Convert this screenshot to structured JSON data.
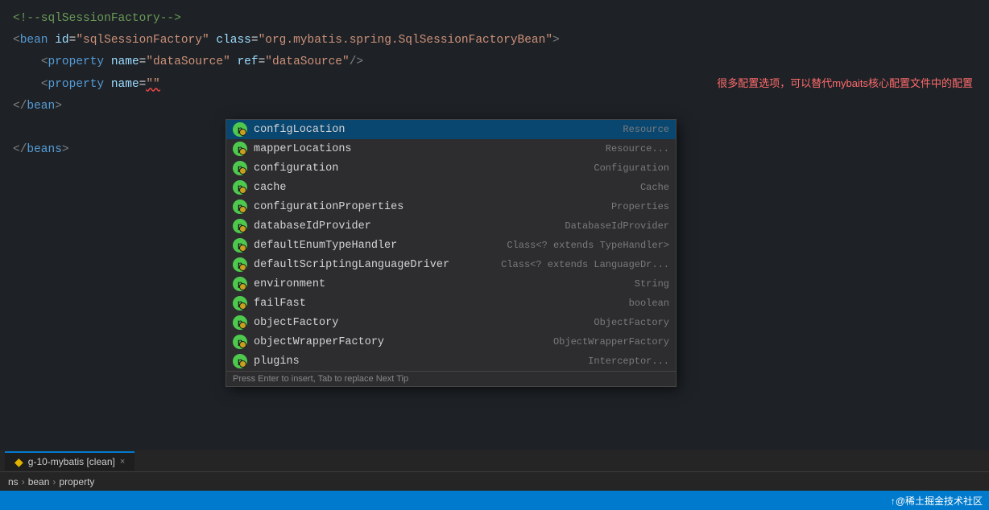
{
  "editor": {
    "background": "#1e2227",
    "lines": [
      {
        "id": "line-comment",
        "content": "<!--sqlSessionFactory-->"
      },
      {
        "id": "line-bean-open",
        "parts": [
          {
            "type": "tag-bracket",
            "text": "<"
          },
          {
            "type": "tag-name",
            "text": "bean"
          },
          {
            "type": "text",
            "text": " "
          },
          {
            "type": "attr-name",
            "text": "id"
          },
          {
            "type": "attr-equals",
            "text": "="
          },
          {
            "type": "attr-value",
            "text": "\"sqlSessionFactory\""
          },
          {
            "type": "text",
            "text": " "
          },
          {
            "type": "attr-name",
            "text": "class"
          },
          {
            "type": "attr-equals",
            "text": "="
          },
          {
            "type": "attr-value",
            "text": "\"org.mybatis.spring.SqlSessionFactoryBean\""
          },
          {
            "type": "tag-bracket",
            "text": ">"
          }
        ]
      },
      {
        "id": "line-property-datasource",
        "indent": "    ",
        "parts": [
          {
            "type": "tag-bracket",
            "text": "<"
          },
          {
            "type": "tag-name",
            "text": "property"
          },
          {
            "type": "text",
            "text": " "
          },
          {
            "type": "attr-name",
            "text": "name"
          },
          {
            "type": "attr-equals",
            "text": "="
          },
          {
            "type": "attr-value",
            "text": "\"dataSource\""
          },
          {
            "type": "text",
            "text": " "
          },
          {
            "type": "attr-name",
            "text": "ref"
          },
          {
            "type": "attr-equals",
            "text": "="
          },
          {
            "type": "attr-value",
            "text": "\"dataSource\""
          },
          {
            "type": "tag-bracket",
            "text": "/>"
          }
        ]
      },
      {
        "id": "line-property-name",
        "indent": "    ",
        "parts": [
          {
            "type": "tag-bracket",
            "text": "<"
          },
          {
            "type": "tag-name",
            "text": "property"
          },
          {
            "type": "text",
            "text": " "
          },
          {
            "type": "attr-name",
            "text": "name"
          },
          {
            "type": "attr-equals",
            "text": "="
          },
          {
            "type": "attr-value-squiggly",
            "text": "\"\""
          }
        ],
        "annotation": "很多配置选项，可以替代mybaits核心配置文件中的配置"
      },
      {
        "id": "line-bean-close",
        "parts": [
          {
            "type": "tag-bracket",
            "text": "</"
          },
          {
            "type": "tag-name",
            "text": "bean"
          },
          {
            "type": "tag-bracket",
            "text": ">"
          }
        ]
      },
      {
        "id": "line-blank"
      },
      {
        "id": "line-beans-close",
        "parts": [
          {
            "type": "tag-bracket",
            "text": "</"
          },
          {
            "type": "tag-name",
            "text": "beans"
          },
          {
            "type": "tag-bracket",
            "text": ">"
          }
        ]
      }
    ]
  },
  "autocomplete": {
    "items": [
      {
        "label": "configLocation",
        "type": "Resource",
        "selected": true
      },
      {
        "label": "mapperLocations",
        "type": "Resource..."
      },
      {
        "label": "configuration",
        "type": "Configuration"
      },
      {
        "label": "cache",
        "type": "Cache"
      },
      {
        "label": "configurationProperties",
        "type": "Properties"
      },
      {
        "label": "databaseIdProvider",
        "type": "DatabaseIdProvider"
      },
      {
        "label": "defaultEnumTypeHandler",
        "type": "Class<? extends TypeHandler>"
      },
      {
        "label": "defaultScriptingLanguageDriver",
        "type": "Class<? extends LanguageDr..."
      },
      {
        "label": "environment",
        "type": "String"
      },
      {
        "label": "failFast",
        "type": "boolean"
      },
      {
        "label": "objectFactory",
        "type": "ObjectFactory"
      },
      {
        "label": "objectWrapperFactory",
        "type": "ObjectWrapperFactory"
      },
      {
        "label": "plugins",
        "type": "Interceptor..."
      }
    ],
    "footer": "Press Enter to insert, Tab to replace   Next Tip"
  },
  "breadcrumb": {
    "items": [
      "ns",
      "bean",
      "property"
    ]
  },
  "tab": {
    "label": "g-10-mybatis [clean]",
    "symbol": "◆",
    "close": "×"
  },
  "statusbar": {
    "left": "",
    "right": "↑@稀土掘金技术社区"
  }
}
